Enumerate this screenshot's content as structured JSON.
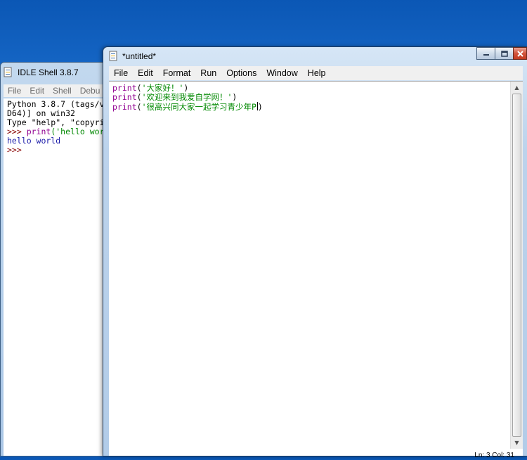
{
  "shell": {
    "title": "IDLE Shell 3.8.7",
    "menu": [
      "File",
      "Edit",
      "Shell",
      "Debu"
    ],
    "lines": [
      [
        {
          "t": "Python 3.8.7 (tags/v",
          "c": "c-black"
        }
      ],
      [
        {
          "t": "D64)] on win32",
          "c": "c-black"
        }
      ],
      [
        {
          "t": "Type \"help\", \"copyri",
          "c": "c-black"
        }
      ],
      [
        {
          "t": ">>> ",
          "c": "c-dkred"
        },
        {
          "t": "print",
          "c": "c-purple"
        },
        {
          "t": "('hello wor",
          "c": "c-green"
        }
      ],
      [
        {
          "t": "hello world",
          "c": "c-blue"
        }
      ],
      [
        {
          "t": ">>> ",
          "c": "c-dkred"
        }
      ]
    ]
  },
  "editor": {
    "title": "*untitled*",
    "menu": [
      "File",
      "Edit",
      "Format",
      "Run",
      "Options",
      "Window",
      "Help"
    ],
    "lines": [
      [
        {
          "t": "print",
          "c": "c-purple"
        },
        {
          "t": "(",
          "c": "c-black"
        },
        {
          "t": "'大家好！'",
          "c": "c-green"
        },
        {
          "t": ")",
          "c": "c-black"
        }
      ],
      [
        {
          "t": "print",
          "c": "c-purple"
        },
        {
          "t": "(",
          "c": "c-black"
        },
        {
          "t": "'欢迎来到我爱自学网！'",
          "c": "c-green"
        },
        {
          "t": ")",
          "c": "c-black"
        }
      ],
      [
        {
          "t": "print",
          "c": "c-purple"
        },
        {
          "t": "(",
          "c": "c-black"
        },
        {
          "t": "'很高兴同大家一起学习青少年P",
          "c": "c-green"
        },
        {
          "t": "|",
          "c": "cursor"
        },
        {
          "t": ")",
          "c": "c-black"
        }
      ]
    ],
    "status": "Ln: 3  Col: 31"
  }
}
